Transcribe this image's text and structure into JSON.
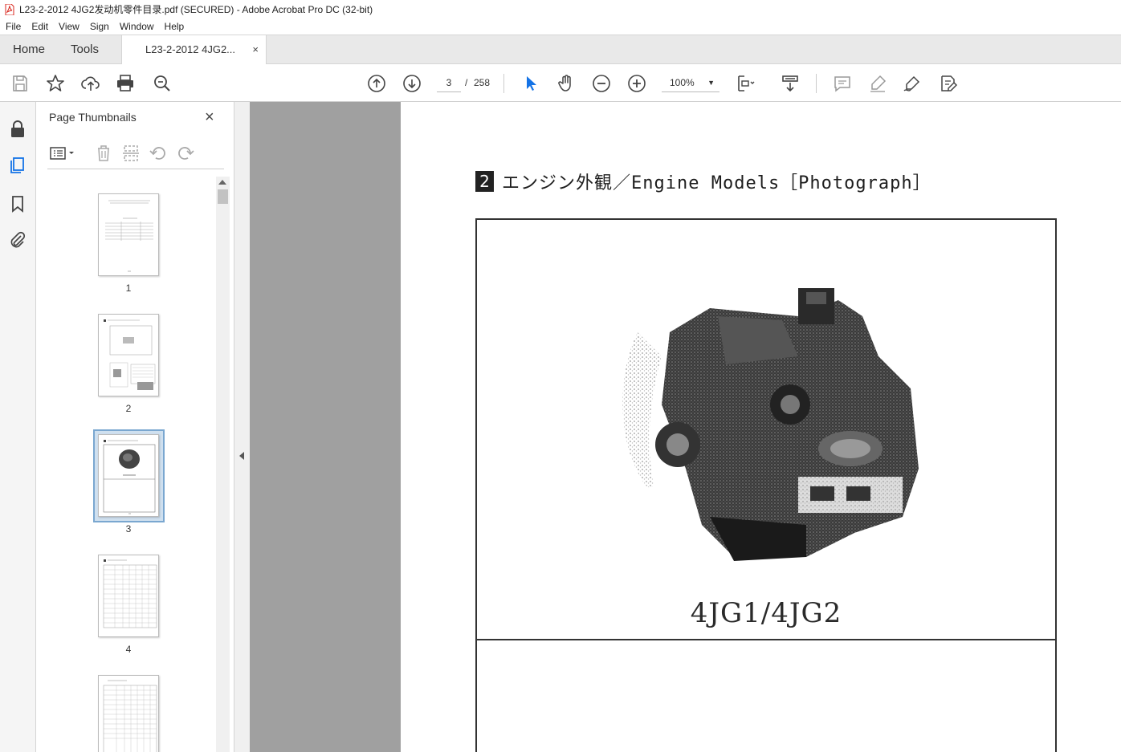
{
  "window": {
    "title": "L23-2-2012  4JG2发动机零件目录.pdf (SECURED) - Adobe Acrobat Pro DC (32-bit)"
  },
  "menu": [
    "File",
    "Edit",
    "View",
    "Sign",
    "Window",
    "Help"
  ],
  "tabs": {
    "home": "Home",
    "tools": "Tools",
    "document": "L23-2-2012  4JG2...",
    "close": "×"
  },
  "toolbar": {
    "current_page": "3",
    "separator": "/",
    "total_pages": "258",
    "zoom": "100%",
    "icons": [
      "save-icon",
      "star-icon",
      "upload-icon",
      "print-icon",
      "search-zoom-icon",
      "prev-page-icon",
      "next-page-icon",
      "select-arrow-icon",
      "hand-icon",
      "zoom-out-icon",
      "zoom-in-icon",
      "page-display-icon",
      "scroll-mode-icon",
      "comment-icon",
      "highlight-icon",
      "sign-icon",
      "edit-pdf-icon"
    ]
  },
  "sidebar": {
    "icons": [
      "lock-icon",
      "pages-icon",
      "bookmark-icon",
      "attachment-icon"
    ]
  },
  "thumbnails": {
    "title": "Page Thumbnails",
    "close": "×",
    "pages": [
      "1",
      "2",
      "3",
      "4"
    ],
    "selected": "3"
  },
  "document": {
    "section_number": "2",
    "heading": "エンジン外観／Engine Models［Photograph］",
    "caption": "4JG1/4JG2"
  },
  "colors": {
    "accent": "#1473e6",
    "pdf_red": "#d9261c",
    "selection": "#7aa7d0"
  }
}
